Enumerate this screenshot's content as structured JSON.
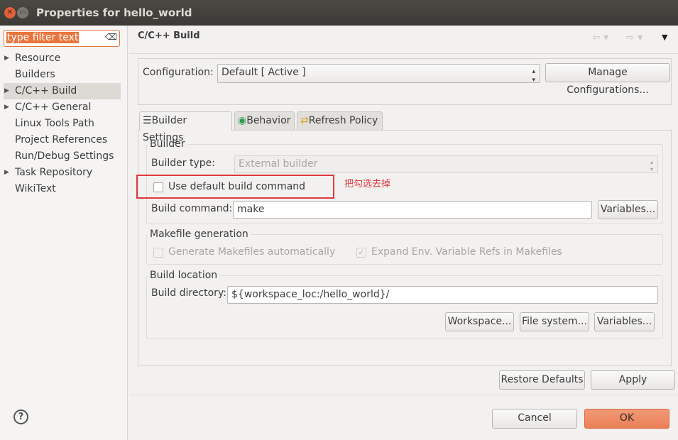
{
  "window": {
    "title": "Properties for hello_world"
  },
  "sidebar": {
    "filter_text": "type filter text",
    "items": [
      {
        "label": "Resource",
        "expandable": true
      },
      {
        "label": "Builders",
        "expandable": false
      },
      {
        "label": "C/C++ Build",
        "expandable": true,
        "selected": true
      },
      {
        "label": "C/C++ General",
        "expandable": true
      },
      {
        "label": "Linux Tools Path",
        "expandable": false
      },
      {
        "label": "Project References",
        "expandable": false
      },
      {
        "label": "Run/Debug Settings",
        "expandable": false
      },
      {
        "label": "Task Repository",
        "expandable": true
      },
      {
        "label": "WikiText",
        "expandable": false
      }
    ]
  },
  "header": {
    "title": "C/C++ Build"
  },
  "config": {
    "label": "Configuration:",
    "value": "Default  [ Active ]",
    "manage_label": "Manage Configurations..."
  },
  "tabs": [
    {
      "label": "Builder Settings",
      "active": true
    },
    {
      "label": "Behavior"
    },
    {
      "label": "Refresh Policy"
    }
  ],
  "builder": {
    "group": "Builder",
    "type_label": "Builder type:",
    "type_value": "External builder",
    "use_default_label": "Use default build command",
    "use_default_checked": false,
    "command_label": "Build command:",
    "command_value": "make",
    "variables_label": "Variables..."
  },
  "annotation": {
    "text": "把勾选去掉",
    "color": "#e0393e"
  },
  "makefile": {
    "group": "Makefile generation",
    "generate_label": "Generate Makefiles automatically",
    "generate_checked": false,
    "expand_label": "Expand Env. Variable Refs in Makefiles",
    "expand_checked": true
  },
  "location": {
    "group": "Build location",
    "dir_label": "Build directory:",
    "dir_value": "${workspace_loc:/hello_world}/",
    "workspace_label": "Workspace...",
    "filesystem_label": "File system...",
    "variables_label": "Variables..."
  },
  "buttons": {
    "restore": "Restore Defaults",
    "apply": "Apply",
    "cancel": "Cancel",
    "ok": "OK",
    "help": "?"
  },
  "colors": {
    "accent": "#e9764a"
  }
}
